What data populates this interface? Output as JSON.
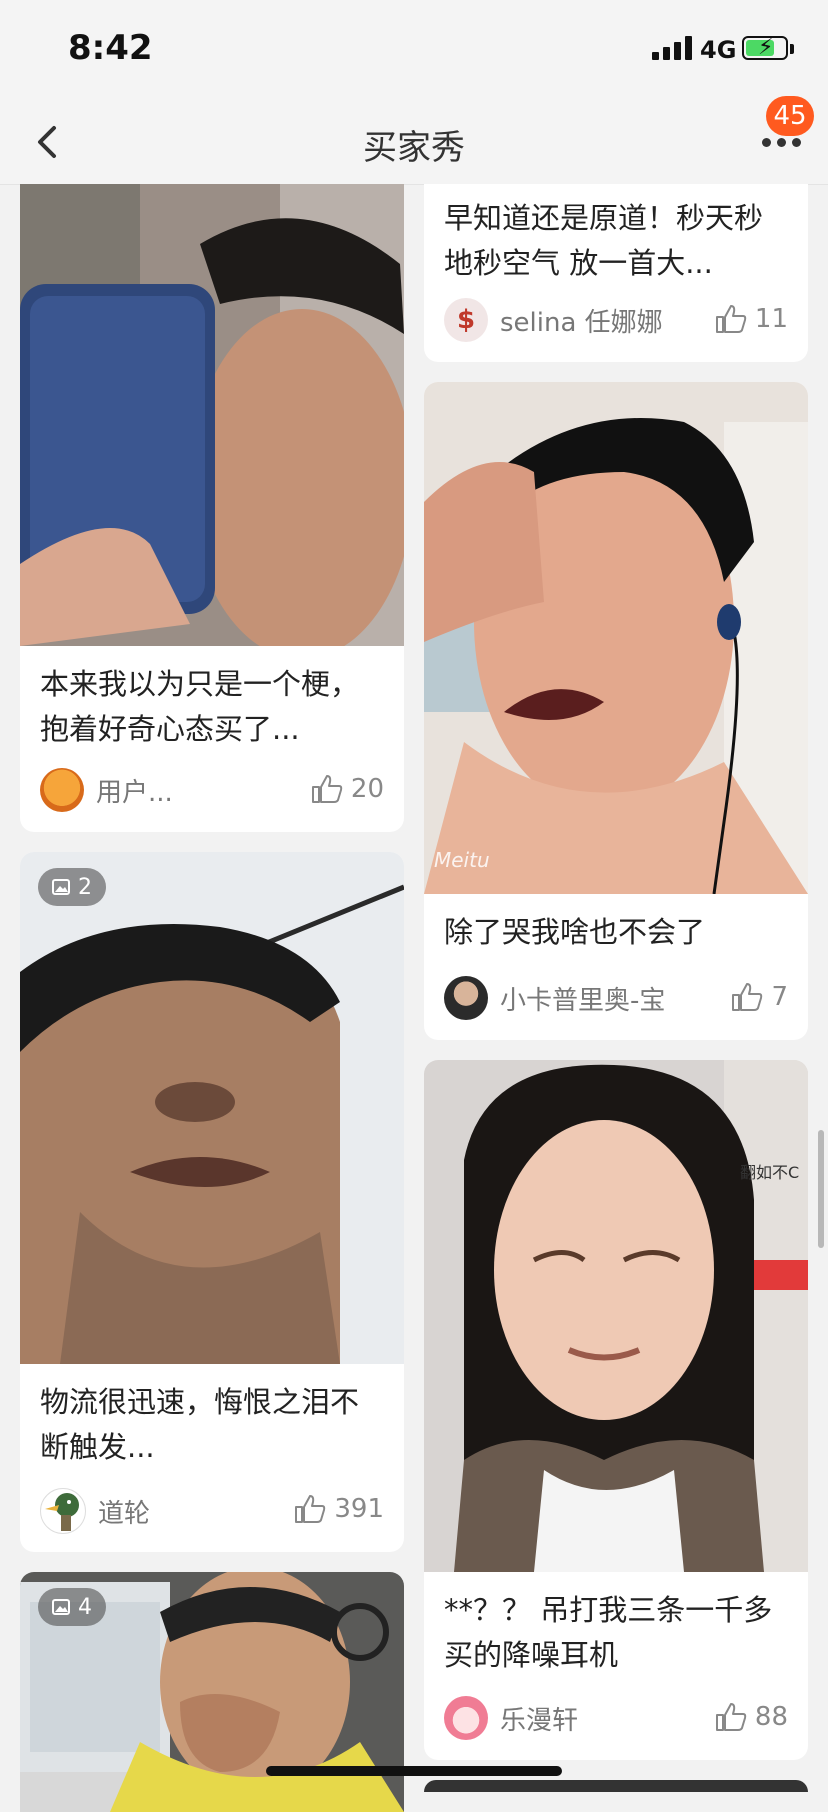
{
  "status_bar": {
    "time": "8:42",
    "network": "4G"
  },
  "nav": {
    "title": "买家秀",
    "badge": "45"
  },
  "cards": [
    {
      "caption": "本来我以为只是一个梗，抱着好奇心态买了...",
      "user": "用户...",
      "likes": "20"
    },
    {
      "photo_count": "2",
      "caption": "物流很迅速，悔恨之泪不断触发...",
      "user": "道轮",
      "likes": "391"
    },
    {
      "photo_count": "4"
    },
    {
      "caption": "早知道还是原道！秒天秒地秒空气 放一首大...",
      "user": "selina 任娜娜",
      "likes": "11"
    },
    {
      "caption": "除了哭我啥也不会了",
      "user": "小卡普里奥-宝",
      "likes": "7"
    },
    {
      "caption": "**？？ 吊打我三条一千多买的降噪耳机",
      "user": "乐漫轩",
      "likes": "88"
    }
  ],
  "images": {
    "watermark": "Meitu",
    "sign_text": "翻如不C"
  },
  "icons": {
    "back": "chevron-left-icon",
    "more": "more-dots-icon",
    "like": "thumbs-up-icon",
    "photos": "image-icon"
  }
}
